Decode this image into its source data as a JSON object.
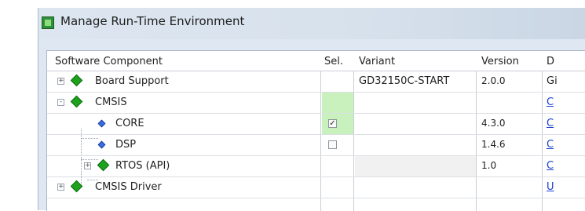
{
  "window": {
    "title": "Manage Run-Time Environment"
  },
  "columns": {
    "component": "Software Component",
    "sel": "Sel.",
    "variant": "Variant",
    "version": "Version",
    "description": "D"
  },
  "rows": [
    {
      "name": "Board Support",
      "variant": "GD32150C-START",
      "version": "2.0.0",
      "desc": "Gi",
      "expander": "+",
      "selected": null
    },
    {
      "name": "CMSIS",
      "variant": "",
      "version": "",
      "desc": "C",
      "expander": "-",
      "selected": null
    },
    {
      "name": "CORE",
      "variant": "",
      "version": "4.3.0",
      "desc": "C",
      "expander": "",
      "selected": true
    },
    {
      "name": "DSP",
      "variant": "",
      "version": "1.4.6",
      "desc": "C",
      "expander": "",
      "selected": false
    },
    {
      "name": "RTOS (API)",
      "variant": "",
      "version": "1.0",
      "desc": "C",
      "expander": "+",
      "selected": null
    },
    {
      "name": "CMSIS Driver",
      "variant": "",
      "version": "",
      "desc": "U",
      "expander": "+",
      "selected": null
    }
  ],
  "colors": {
    "selected_cell": "#c9f1bd",
    "link": "#1a3fd0",
    "component_icon": "#1ea21e",
    "sub_icon": "#3a6ee0"
  }
}
